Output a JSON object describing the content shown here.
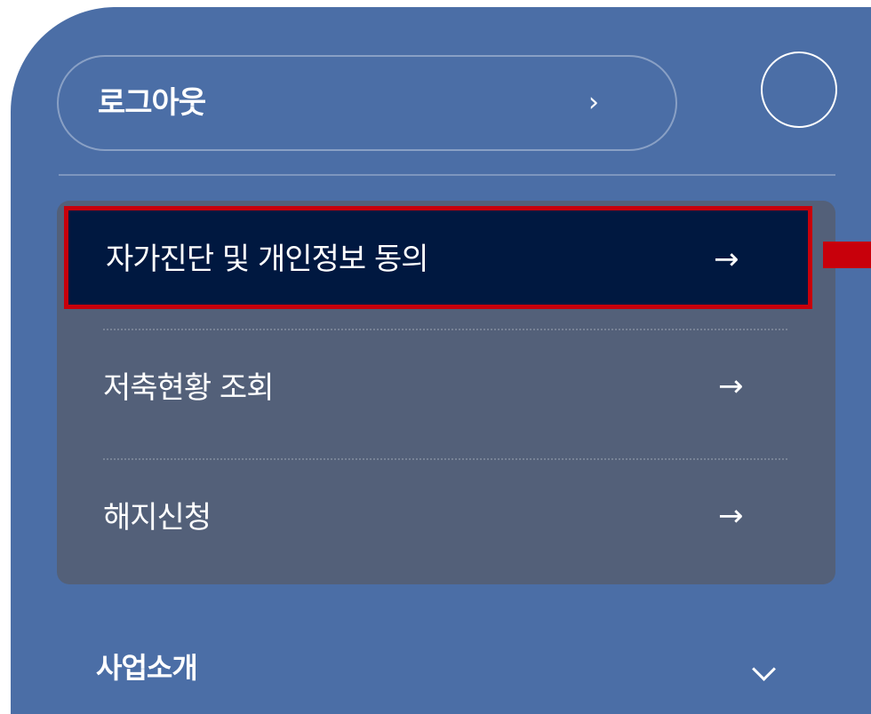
{
  "account": {
    "logout_label": "로그아웃",
    "logout_chevron": "›"
  },
  "menu": {
    "items": [
      {
        "label": "자가진단 및 개인정보 동의",
        "arrow": "→",
        "active": true
      },
      {
        "label": "저축현황 조회",
        "arrow": "→",
        "active": false
      },
      {
        "label": "해지신청",
        "arrow": "→",
        "active": false
      }
    ]
  },
  "sections": [
    {
      "label": "사업소개",
      "expanded": false
    }
  ],
  "colors": {
    "panel_bg": "#4b6ea6",
    "submenu_bg": "#536079",
    "active_bg": "#001840",
    "highlight": "#c8000b"
  },
  "icons": {
    "profile": "profile-circle-icon",
    "logout_chevron": "chevron-right-icon",
    "item_arrow": "arrow-right-icon",
    "section_chevron": "chevron-down-icon"
  }
}
